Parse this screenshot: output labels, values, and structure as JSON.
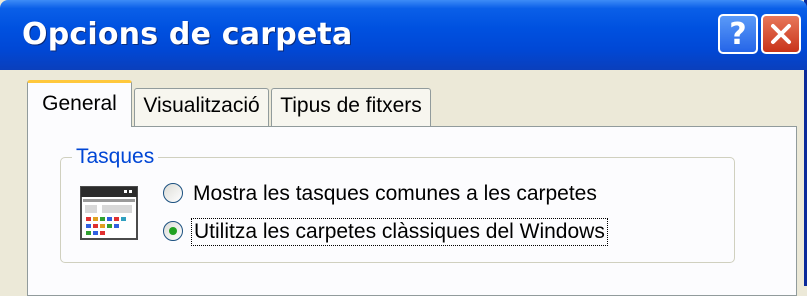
{
  "window": {
    "title": "Opcions de carpeta",
    "help_button": "?",
    "close_button": "close"
  },
  "tabs": [
    {
      "label": "General",
      "active": true
    },
    {
      "label": "Visualització",
      "active": false
    },
    {
      "label": "Tipus de fitxers",
      "active": false
    }
  ],
  "tasks_group": {
    "label": "Tasques",
    "icon": "folder-window-icon",
    "options": [
      {
        "label": "Mostra les tasques comunes a les carpetes",
        "selected": false
      },
      {
        "label": "Utilitza les carpetes clàssiques del Windows",
        "selected": true
      }
    ]
  },
  "colors": {
    "titlebar": "#0051e0",
    "dialog_bg": "#ece9d8",
    "group_label": "#0046d5",
    "radio_selected": "#21a121"
  }
}
